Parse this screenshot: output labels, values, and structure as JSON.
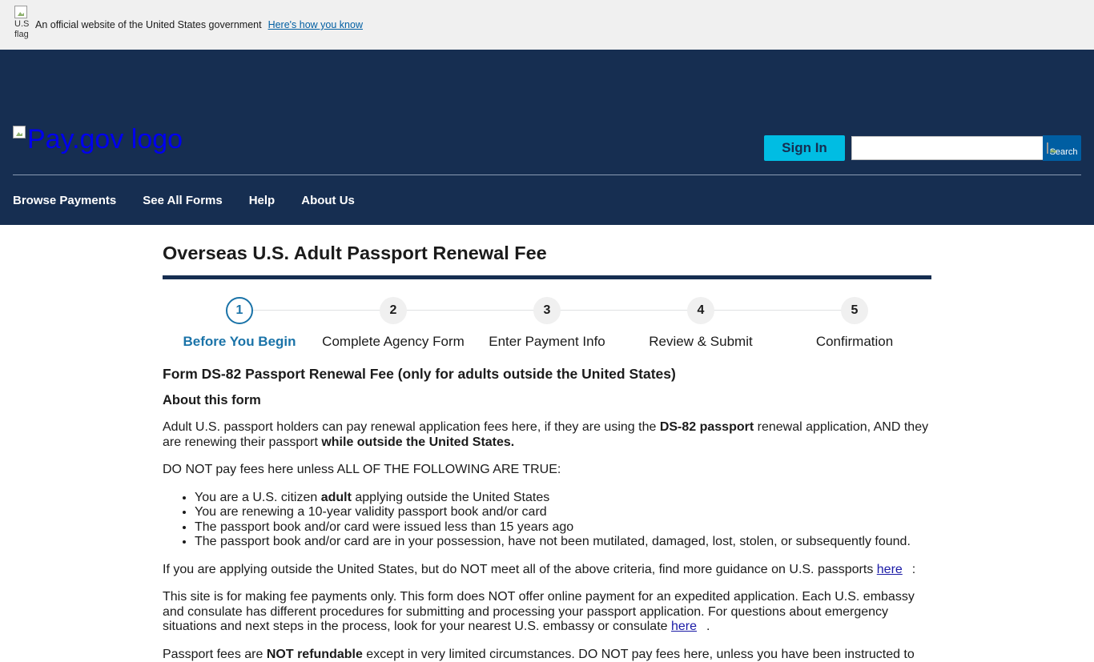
{
  "gov_banner": {
    "flag_alt": "U.S. flag",
    "text": "An official website of the United States government",
    "link": "Here's how you know"
  },
  "header": {
    "logo_alt": "Pay.gov logo",
    "signin_label": "Sign In",
    "search_value": "",
    "search_button_alt": "Search",
    "brand_color": "#162e51",
    "accent_color": "#00bde3"
  },
  "nav": {
    "items": [
      "Browse Payments",
      "See All Forms",
      "Help",
      "About Us"
    ]
  },
  "main": {
    "title": "Overseas U.S. Adult Passport Renewal Fee",
    "steps": [
      {
        "number": "1",
        "label": "Before You Begin",
        "active": true
      },
      {
        "number": "2",
        "label": "Complete Agency Form",
        "active": false
      },
      {
        "number": "3",
        "label": "Enter Payment Info",
        "active": false
      },
      {
        "number": "4",
        "label": "Review & Submit",
        "active": false
      },
      {
        "number": "5",
        "label": "Confirmation",
        "active": false
      }
    ],
    "form_heading": "Form DS-82 Passport Renewal Fee (only for adults outside the United States)",
    "about_heading": "About this form",
    "p1_a": "Adult U.S. passport holders can pay renewal application fees here, if they are using the ",
    "p1_b": "DS-82 passport",
    "p1_c": " renewal application, AND they are renewing their passport ",
    "p1_d": "while outside the United States.",
    "p2": "DO NOT pay fees here unless ALL OF THE FOLLOWING ARE TRUE:",
    "li1_a": "You are a U.S. citizen ",
    "li1_b": "adult",
    "li1_c": " applying outside the United States",
    "li2": "You are renewing a 10-year validity passport book and/or card",
    "li3": "The passport book and/or card were issued less than 15 years ago",
    "li4": "The passport book and/or card are in your possession, have not been mutilated, damaged, lost, stolen, or subsequently found.",
    "p3_a": "If you are applying outside the United States, but do NOT meet all of the above criteria, find more guidance on U.S. passports ",
    "p3_link": "here",
    "p3_end": ":",
    "p4_a": "This site is for making fee payments only. This form does NOT offer online payment for an expedited application. Each U.S. embassy and consulate has different procedures for submitting and processing your passport application. For questions about emergency situations and next steps in the process, look for your nearest U.S. embassy or consulate ",
    "p4_link": "here",
    "p4_end": ".",
    "p5_a": "Passport fees are ",
    "p5_b": "NOT refundable",
    "p5_c": " except in very limited circumstances. DO NOT pay fees here, unless you have been instructed to"
  }
}
